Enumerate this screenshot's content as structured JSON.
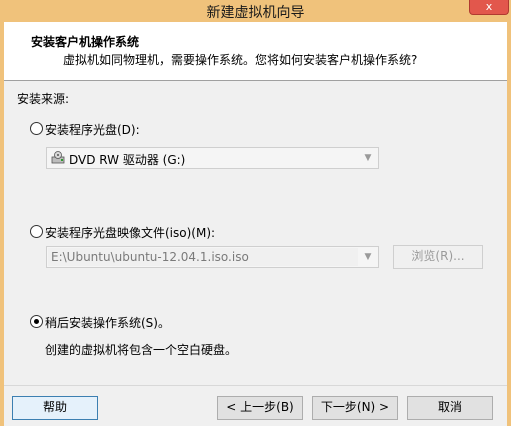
{
  "window": {
    "title": "新建虚拟机向导",
    "close_glyph": "x"
  },
  "header": {
    "title": "安装客户机操作系统",
    "subtitle": "虚拟机如同物理机，需要操作系统。您将如何安装客户机操作系统?"
  },
  "source": {
    "label": "安装来源:",
    "options": [
      {
        "label": "安装程序光盘(D):",
        "selected": false
      },
      {
        "label": "安装程序光盘映像文件(iso)(M):",
        "selected": false
      },
      {
        "label": "稍后安装操作系统(S)。",
        "selected": true
      }
    ],
    "disc_combo_value": "DVD RW 驱动器 (G:)",
    "iso_path": "E:\\Ubuntu\\ubuntu-12.04.1.iso.iso",
    "browse_label": "浏览(R)...",
    "later_note": "创建的虚拟机将包含一个空白硬盘。"
  },
  "buttons": {
    "help": "帮助",
    "back": "< 上一步(B)",
    "next": "下一步(N) >",
    "cancel": "取消"
  }
}
